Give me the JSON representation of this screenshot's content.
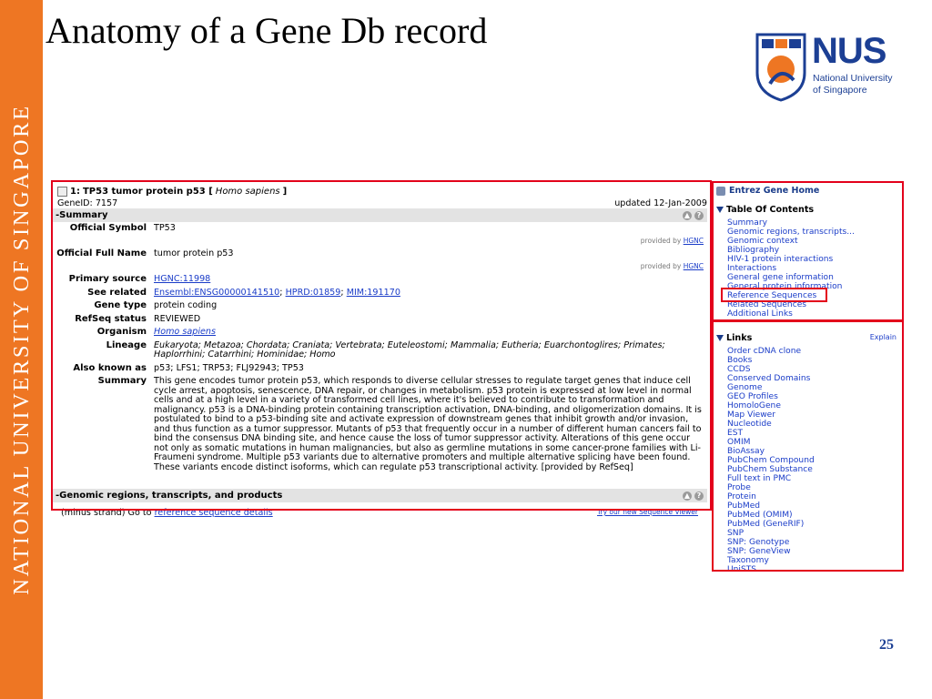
{
  "slide": {
    "title": "Anatomy of a Gene Db record",
    "side_text": "NATIONAL UNIVERSITY OF SINGAPORE",
    "page_number": "25",
    "logo": {
      "name": "NUS",
      "line1": "National University",
      "line2": "of Singapore"
    },
    "colors": {
      "band": "#ee7623",
      "logo_blue": "#1c3f94",
      "highlight": "#e3001b",
      "link": "#1a3cc8"
    }
  },
  "record": {
    "index": "1:",
    "title": "TP53 tumor protein p53 [",
    "organism": "Homo sapiens",
    "title_close": "]",
    "gene_id": "GeneID: 7157",
    "updated": "updated 12-Jan-2009",
    "summary_header": "-Summary",
    "rows": [
      {
        "label": "Official Symbol",
        "value": "TP53",
        "provided": "provided by",
        "provider": "HGNC"
      },
      {
        "label": "Official Full Name",
        "value": "tumor protein p53",
        "provided": "provided by",
        "provider": "HGNC"
      },
      {
        "label": "Primary source",
        "value": "HGNC:11998"
      },
      {
        "label": "See related",
        "links": [
          "Ensembl:ENSG00000141510",
          "HPRD:01859",
          "MIM:191170"
        ]
      },
      {
        "label": "Gene type",
        "value": "protein coding"
      },
      {
        "label": "RefSeq status",
        "value": "REVIEWED"
      },
      {
        "label": "Organism",
        "value": "Homo sapiens"
      },
      {
        "label": "Lineage",
        "value": "Eukaryota; Metazoa; Chordata; Craniata; Vertebrata; Euteleostomi; Mammalia; Eutheria; Euarchontoglires; Primates; Haplorrhini; Catarrhini; Hominidae; Homo"
      },
      {
        "label": "Also known as",
        "value": "p53; LFS1; TRP53; FLJ92943; TP53"
      },
      {
        "label": "Summary",
        "value": "This gene encodes tumor protein p53, which responds to diverse cellular stresses to regulate target genes that induce cell cycle arrest, apoptosis, senescence, DNA repair, or changes in metabolism. p53 protein is expressed at low level in normal cells and at a high level in a variety of transformed cell lines, where it's believed to contribute to transformation and malignancy. p53 is a DNA-binding protein containing transcription activation, DNA-binding, and oligomerization domains. It is postulated to bind to a p53-binding site and activate expression of downstream genes that inhibit growth and/or invasion, and thus function as a tumor suppressor. Mutants of p53 that frequently occur in a number of different human cancers fail to bind the consensus DNA binding site, and hence cause the loss of tumor suppressor activity. Alterations of this gene occur not only as somatic mutations in human malignancies, but also as germline mutations in some cancer-prone families with Li-Fraumeni syndrome. Multiple p53 variants due to alternative promoters and multiple alternative splicing have been found. These variants encode distinct isoforms, which can regulate p53 transcriptional activity. [provided by RefSeq]"
      }
    ],
    "genomic": {
      "header": "-Genomic regions, transcripts, and products",
      "text_prefix": "(minus strand) Go to",
      "link": "reference sequence details",
      "viewer_link": "Try our new Sequence Viewer"
    }
  },
  "right": {
    "home": "Entrez Gene Home",
    "toc_title": "Table Of Contents",
    "toc": [
      "Summary",
      "Genomic regions, transcripts...",
      "Genomic context",
      "Bibliography",
      "HIV-1 protein interactions",
      "Interactions",
      "General gene information",
      "General protein information",
      "Reference Sequences",
      "Related Sequences",
      "Additional Links"
    ],
    "links_title": "Links",
    "explain": "Explain",
    "links": [
      "Order cDNA clone",
      "Books",
      "CCDS",
      "Conserved Domains",
      "Genome",
      "GEO Profiles",
      "HomoloGene",
      "Map Viewer",
      "Nucleotide",
      "EST",
      "OMIM",
      "BioAssay",
      "PubChem Compound",
      "PubChem Substance",
      "Full text in PMC",
      "Probe",
      "Protein",
      "PubMed",
      "PubMed (OMIM)",
      "PubMed (GeneRIF)",
      "SNP",
      "SNP: Genotype",
      "SNP: GeneView",
      "Taxonomy",
      "UniSTS"
    ]
  }
}
